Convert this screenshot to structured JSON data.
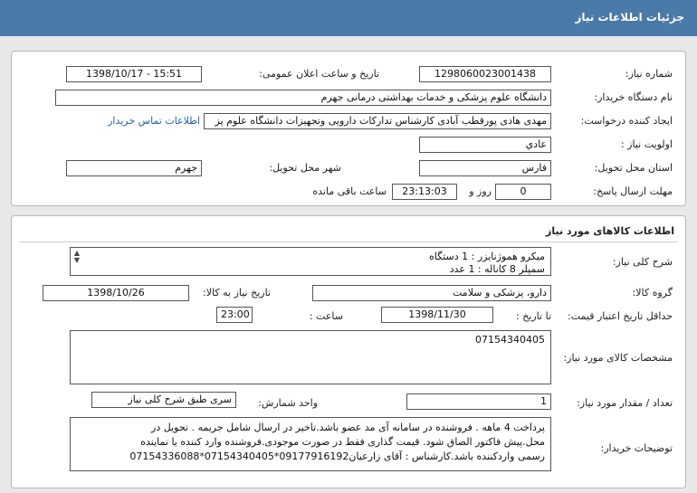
{
  "header": {
    "title": "جزئیات اطلاعات نیاز"
  },
  "details": {
    "need_number_label": "شماره نیاز:",
    "need_number": "1298060023001438",
    "announce_label": "تاریخ و ساعت اعلان عمومی:",
    "announce_value": "1398/10/17 - 15:51",
    "buyer_label": "نام دستگاه خریدار:",
    "buyer_value": "دانشگاه علوم پزشکی و خدمات بهداشتی درمانی جهرم",
    "creator_label": "ایجاد کننده درخواست:",
    "creator_value": "مهدی هادی پورقطب آبادی کارشناس تدارکات دارویی وتجهیزات دانشگاه علوم پز",
    "contact_link": "اطلاعات تماس خریدار",
    "priority_label": "اولویت نیاز :",
    "priority_value": "عادي",
    "province_label": "استان محل تحویل:",
    "province_value": "فارس",
    "city_label": "شهر محل تحویل:",
    "city_value": "جهرم",
    "deadline_label": "مهلت ارسال پاسخ:",
    "days_value": "0",
    "days_label": "روز و",
    "time_value": "23:13:03",
    "remaining_label": "ساعت باقی مانده"
  },
  "goods": {
    "section_title": "اطلاعات کالاهای مورد نیاز",
    "summary_label": "شرح کلی نیاز:",
    "summary_lines": [
      "میکرو هموژنایزر : 1 دستگاه",
      "سمپلر 8 کاناله : 1 عدد"
    ],
    "need_date_label": "تاریخ نیاز به کالا:",
    "need_date_value": "1398/10/26",
    "group_label": "گروه کالا:",
    "group_value": "دارو، پزشکی و سلامت",
    "validity_label": "حداقل تاریخ اعتبار قیمت:",
    "until_label": "تا تاریخ :",
    "validity_date": "1398/11/30",
    "hour_label": "ساعت :",
    "validity_time": "23:00",
    "spec_label": "مشخصات کالای مورد نیاز:",
    "spec_value": "07154340405",
    "qty_label": "تعداد / مقدار مورد نیاز:",
    "qty_value": "1",
    "unit_label": "واحد شمارش:",
    "unit_value": "سری طبق شرح کلی نیاز",
    "notes_label": "توضیحات خریدار:",
    "notes_lines": [
      "پرداخت 4 ماهه . فروشنده در سامانه آی مد عضو باشد.تاخیر در ارسال شامل جریمه  . تحویل در",
      "محل.پیش فاکتور الصاق شود. قیمت گذاری فقط در صورت موجودی.فروشنده وارد کننده یا نماینده",
      "رسمی واردکننده باشد.کارشناس : آقای زارعیان09177916192*07154340405*07154336088"
    ]
  }
}
